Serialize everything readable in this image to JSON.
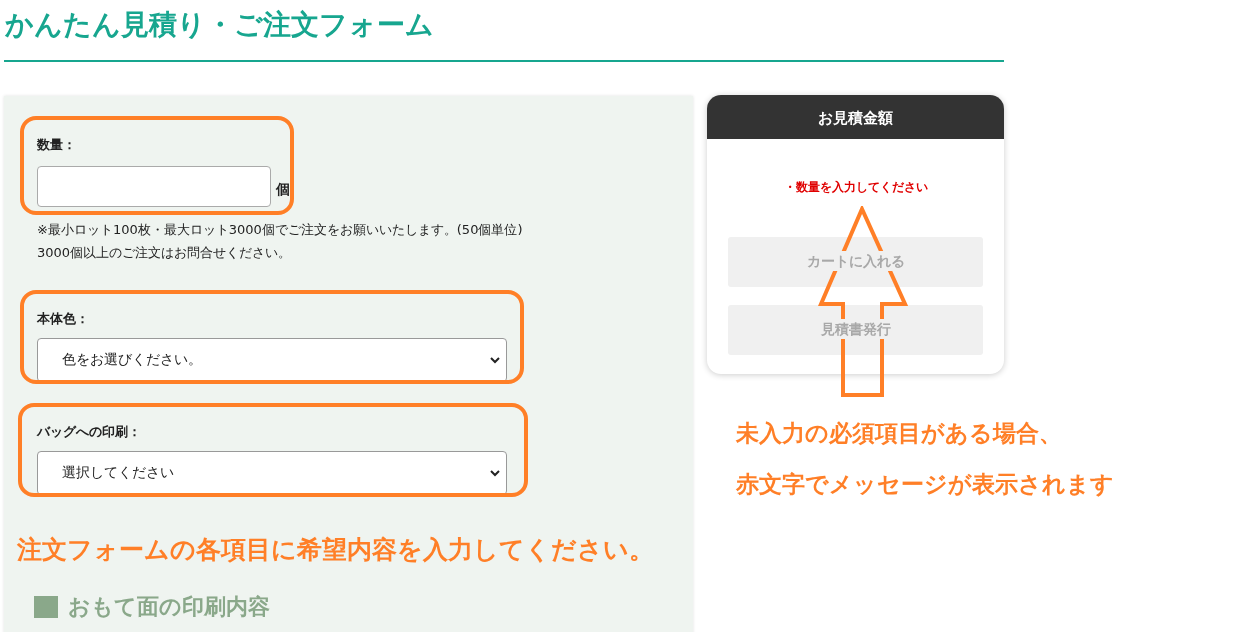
{
  "title": "かんたん見積り・ご注文フォーム",
  "form": {
    "fields": [
      {
        "kind": "number",
        "label": "数量：",
        "unit": "個",
        "notes": [
          "※最小ロット100枚・最大ロット3000個でご注文をお願いいたします。(50個単位)",
          "3000個以上のご注文はお問合せください。"
        ],
        "highlighted": true
      },
      {
        "kind": "select",
        "label": "本体色：",
        "value": "色をお選びください。",
        "highlighted": true
      },
      {
        "kind": "select",
        "label": "バッグへの印刷：",
        "value": "選択してください",
        "highlighted": true
      }
    ],
    "instruction": "注文フォームの各項目に希望内容を入力してください。",
    "section_heading": "おもて面の印刷内容"
  },
  "summary": {
    "header": "お見積金額",
    "error": "・数量を入力してください",
    "buttons": [
      {
        "label": "カートに入れる",
        "disabled": true
      },
      {
        "label": "見積書発行",
        "disabled": true
      }
    ]
  },
  "callout": [
    "未入力の必須項目がある場合、",
    "赤文字でメッセージが表示されます"
  ]
}
